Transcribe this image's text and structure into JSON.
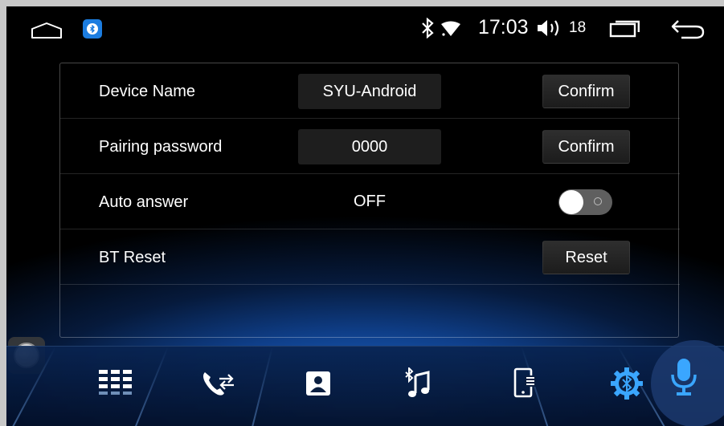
{
  "status_bar": {
    "time": "17:03",
    "volume_level": "18",
    "icons": [
      "home-icon",
      "bluetooth-app-icon",
      "bluetooth-icon",
      "wifi-icon",
      "volume-icon",
      "recents-icon",
      "back-icon"
    ]
  },
  "settings": {
    "rows": [
      {
        "label": "Device Name",
        "value": "SYU-Android",
        "button": "Confirm"
      },
      {
        "label": "Pairing password",
        "value": "0000",
        "button": "Confirm"
      },
      {
        "label": "Auto answer",
        "value": "OFF",
        "toggle_on": false
      },
      {
        "label": "BT Reset",
        "button": "Reset"
      }
    ]
  },
  "dock": {
    "items": [
      "dialpad-icon",
      "call-log-icon",
      "contacts-icon",
      "bt-music-icon",
      "phone-sync-icon",
      "bt-settings-icon",
      "microphone-icon"
    ],
    "active_item": "bt-settings-icon"
  },
  "colors": {
    "accent_blue": "#1c7de0",
    "dock_active": "#3aa6ff",
    "button_bg": "#262626",
    "toggle_off": "#5f5f5f"
  }
}
